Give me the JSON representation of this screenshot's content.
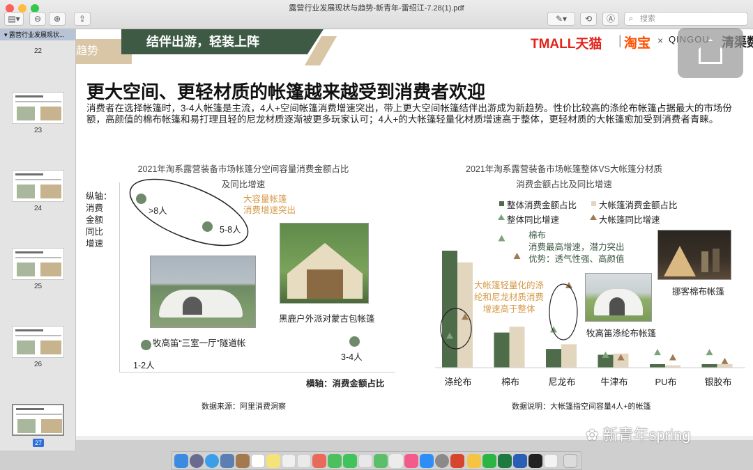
{
  "window": {
    "title": "露营行业发展现状与趋势-新青年-雷绍江-7.28(1).pdf",
    "search_placeholder": "搜索"
  },
  "sidebar": {
    "doc_title": "露营行业发展现状...",
    "pages": [
      {
        "label": "22"
      },
      {
        "label": "23"
      },
      {
        "label": "24"
      },
      {
        "label": "25"
      },
      {
        "label": "26"
      },
      {
        "label": "27",
        "selected": true
      }
    ]
  },
  "slide": {
    "banner": "结伴出游，轻装上阵",
    "banner_left": "趋势",
    "logos": {
      "tmall": "TMALL天猫",
      "taobao": "淘宝",
      "times": "×",
      "partner": "QINGOU",
      "partner_cn": "清渠数"
    },
    "title": "更大空间、更轻材质的帐篷越来越受到消费者欢迎",
    "intro": "消费者在选择帐篷时，3-4人帐篷是主流，4人+空间帐篷消费增速突出，带上更大空间帐篷结伴出游成为新趋势。性价比较高的涤纶布帐篷占据最大的市场份额，高颜值的棉布帐篷和易打理且轻的尼龙材质逐渐被更多玩家认可；4人+的大帐篷轻量化材质增速高于整体，更轻材质的大帐篷愈加受到消费者青睐。"
  },
  "left_chart": {
    "title_line1": "2021年淘系露营装备市场帐篷分空间容量消费金额占比",
    "title_line2": "及同比增速",
    "y_axis_label": [
      "纵轴：",
      "消费",
      "金额",
      "同比",
      "增速"
    ],
    "x_axis_label": "横轴：消费金额占比",
    "callout": [
      "大容量帐篷",
      "消费增速突出"
    ],
    "photo_captions": {
      "tunnel": "牧高笛“三室一厅”隧道帐",
      "yurt": "黑鹿户外派对蒙古包帐篷"
    },
    "source": "数据来源：阿里消费洞察"
  },
  "chart_data": [
    {
      "type": "scatter",
      "points": [
        {
          "label": ">8人"
        },
        {
          "label": "5-8人"
        },
        {
          "label": "1-2人"
        },
        {
          "label": "3-4人"
        }
      ]
    },
    {
      "type": "bar",
      "title_line1": "2021年淘系露营装备市场帐篷整体VS大帐篷分材质",
      "title_line2": "消费金额占比及同比增速",
      "categories": [
        "涤纶布",
        "棉布",
        "尼龙布",
        "牛津布",
        "PU布",
        "银胶布"
      ],
      "series": [
        {
          "name": "整体消费金额占比",
          "kind": "bar",
          "color": "#4e6b4a",
          "values": [
            100,
            30,
            16,
            11,
            3,
            3
          ]
        },
        {
          "name": "大帐篷消费金额占比",
          "kind": "bar",
          "color": "#e3d6bf",
          "values": [
            90,
            35,
            20,
            12,
            2,
            3
          ]
        },
        {
          "name": "整体同比增速",
          "kind": "triangle",
          "color": "#7ea37a",
          "values": [
            25,
            102,
            30,
            10,
            12,
            12
          ]
        },
        {
          "name": "大帐篷同比增速",
          "kind": "triangle",
          "color": "#a07a52",
          "values": [
            40,
            88,
            65,
            8,
            8,
            5
          ]
        }
      ],
      "callouts": {
        "cotton": [
          "棉布",
          "消费最高增速，潜力突出",
          "优势：透气性强、高颜值"
        ],
        "light": [
          "大帐篷轻量化的涤",
          "纶和尼龙材质消费",
          "增速高于整体"
        ]
      },
      "photo_captions": {
        "cotton": "挪客棉布帐篷",
        "polyester": "牧高笛涤纶布帐篷"
      },
      "note": "数据说明：大帐篷指空间容量4人+的帐篷"
    }
  ],
  "watermark": "新青年spring"
}
